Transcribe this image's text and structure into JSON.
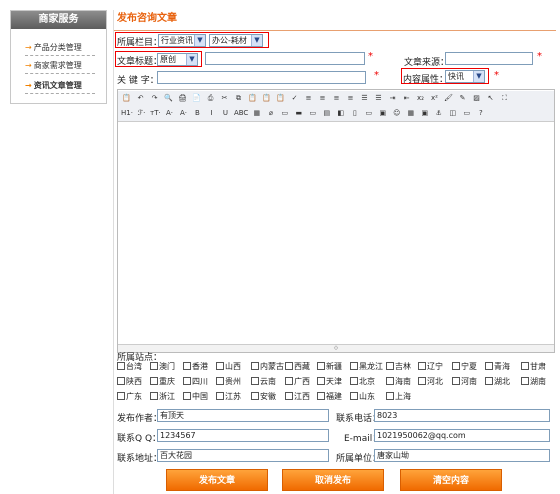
{
  "sidebar": {
    "title": "商家服务",
    "items": [
      {
        "label": "产品分类管理"
      },
      {
        "label": "商家需求管理"
      },
      {
        "label": "资讯文章管理"
      }
    ]
  },
  "page_title": "发布咨询文章",
  "form": {
    "column_label": "所属栏目：",
    "column_select1": "行业资讯",
    "column_select2": "办公-耗材",
    "title_label": "文章标题：",
    "title_type": "原创",
    "source_label": "文章来源：",
    "keyword_label": "关 键 字：",
    "attr_label": "内容属性：",
    "attr_value": "快讯",
    "required_mark": "*"
  },
  "editor": {
    "toolbar_row1": [
      "📋",
      "↶",
      "↷",
      "🔍",
      "🖨",
      "📄",
      "⎙",
      "✂",
      "⧉",
      "📋",
      "📋",
      "📋",
      "✓",
      "≡",
      "≡",
      "≡",
      "≡",
      "☰",
      "☰",
      "⇥",
      "⇤",
      "x₂",
      "x²",
      "🖌",
      "✎",
      "▨",
      "↖",
      "⛶"
    ],
    "toolbar_row2": [
      "H1·",
      "ℱ·",
      "ᴛT·",
      "A·",
      "A·",
      "B",
      "I",
      "U",
      "ABC",
      "▦",
      "⌀",
      "▭",
      "▬",
      "▭",
      "▤",
      "◧",
      "▯",
      "▭",
      "▣",
      "☺",
      "▦",
      "▣",
      "⚓",
      "◫",
      "▭",
      "?"
    ],
    "resize_mark": "⟐"
  },
  "sites_label": "所属站点：",
  "sites": [
    [
      "台湾",
      "澳门",
      "香港",
      "山西",
      "内蒙古",
      "西藏",
      "新疆",
      "黑龙江",
      "吉林",
      "辽宁",
      "宁夏",
      "青海",
      "甘肃"
    ],
    [
      "陕西",
      "重庆",
      "四川",
      "贵州",
      "云南",
      "广西",
      "天津",
      "北京",
      "海南",
      "河北",
      "河南",
      "湖北",
      "湖南"
    ],
    [
      "广东",
      "浙江",
      "中国",
      "江苏",
      "安徽",
      "江西",
      "福建",
      "山东",
      "上海"
    ]
  ],
  "contact": {
    "author_label": "发布作者：",
    "author_value": "有顶天",
    "phone_label": "联系电话：",
    "phone_value": "8023",
    "qq_label": "联系Q Q：",
    "qq_value": "1234567",
    "email_label": "E-mail：",
    "email_value": "1021950062@qq.com",
    "address_label": "联系地址：",
    "address_value": "百大花园",
    "unit_label": "所属单位：",
    "unit_value": "唐家山坳"
  },
  "buttons": {
    "publish": "发布文章",
    "cancel": "取消发布",
    "clear": "清空内容"
  }
}
